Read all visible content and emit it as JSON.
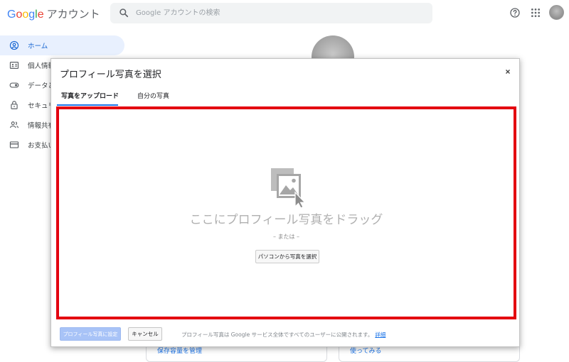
{
  "header": {
    "logo_letters": [
      "G",
      "o",
      "o",
      "g",
      "l",
      "e"
    ],
    "product_name": "アカウント",
    "search_placeholder": "Google アカウントの検索",
    "icons": [
      "search-icon",
      "help-icon",
      "apps-icon",
      "avatar"
    ]
  },
  "sidebar": {
    "items": [
      {
        "label": "ホーム",
        "icon": "home-icon",
        "active": true
      },
      {
        "label": "個人情報",
        "icon": "person-card-icon",
        "active": false
      },
      {
        "label": "データとカスタマイズ",
        "icon": "toggle-icon",
        "active": false
      },
      {
        "label": "セキュリティ",
        "icon": "lock-icon",
        "active": false
      },
      {
        "label": "情報共有と連絡先",
        "icon": "people-icon",
        "active": false
      },
      {
        "label": "お支払いと定期購入",
        "icon": "card-icon",
        "active": false
      }
    ]
  },
  "background": {
    "card_left_link": "保存容量を管理",
    "card_right_link": "使ってみる"
  },
  "dialog": {
    "title": "プロフィール写真を選択",
    "close_icon": "close-icon",
    "tabs": [
      {
        "label": "写真をアップロード",
        "selected": true
      },
      {
        "label": "自分の写真",
        "selected": false
      }
    ],
    "dropzone": {
      "icon": "image-drag-icon",
      "drag_text": "ここにプロフィール写真をドラッグ",
      "or_text": "– または –",
      "select_button": "パソコンから写真を選択"
    },
    "footer": {
      "set_button": "プロフィール写真に設定",
      "cancel_button": "キャンセル",
      "note": "プロフィール写真は Google サービス全体ですべてのユーザーに公開されます。",
      "details_link": "詳細"
    }
  },
  "colors": {
    "highlight_border": "#e3000f",
    "accent": "#1a73e8",
    "active_bg": "#e8f0fe"
  }
}
